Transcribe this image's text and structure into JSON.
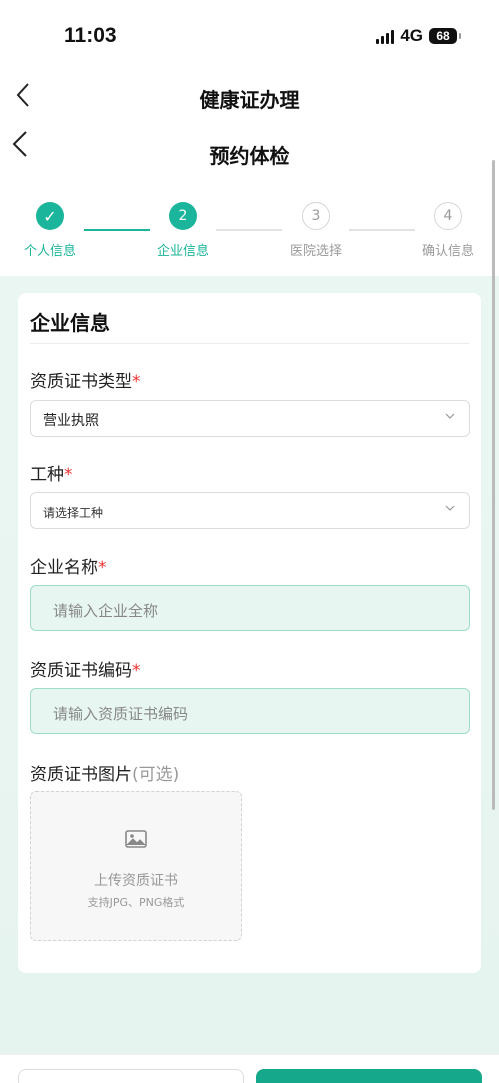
{
  "status_bar": {
    "time": "11:03",
    "network": "4G",
    "battery": "68"
  },
  "nav_outer": {
    "title": "健康证办理",
    "back_icon": "<"
  },
  "nav_inner": {
    "title": "预约体检",
    "back_icon": "<"
  },
  "steps": [
    {
      "number": "✓",
      "label": "个人信息",
      "state": "done"
    },
    {
      "number": "2",
      "label": "企业信息",
      "state": "active"
    },
    {
      "number": "3",
      "label": "医院选择",
      "state": "pending"
    },
    {
      "number": "4",
      "label": "确认信息",
      "state": "pending"
    }
  ],
  "card": {
    "title": "企业信息",
    "fields": {
      "cert_type": {
        "label": "资质证书类型",
        "required": "*",
        "value": "营业执照"
      },
      "job_type": {
        "label": "工种",
        "required": "*",
        "placeholder": "请选择工种"
      },
      "company_name": {
        "label": "企业名称",
        "required": "*",
        "placeholder": "请输入企业全称"
      },
      "cert_code": {
        "label": "资质证书编码",
        "required": "*",
        "placeholder": "请输入资质证书编码"
      },
      "cert_image": {
        "label": "资质证书图片",
        "optional": "(可选)",
        "upload_title": "上传资质证书",
        "upload_hint": "支持JPG、PNG格式"
      }
    }
  },
  "colors": {
    "primary": "#1ab59a",
    "required": "#e33333",
    "input_bg": "#e7f6f0"
  }
}
